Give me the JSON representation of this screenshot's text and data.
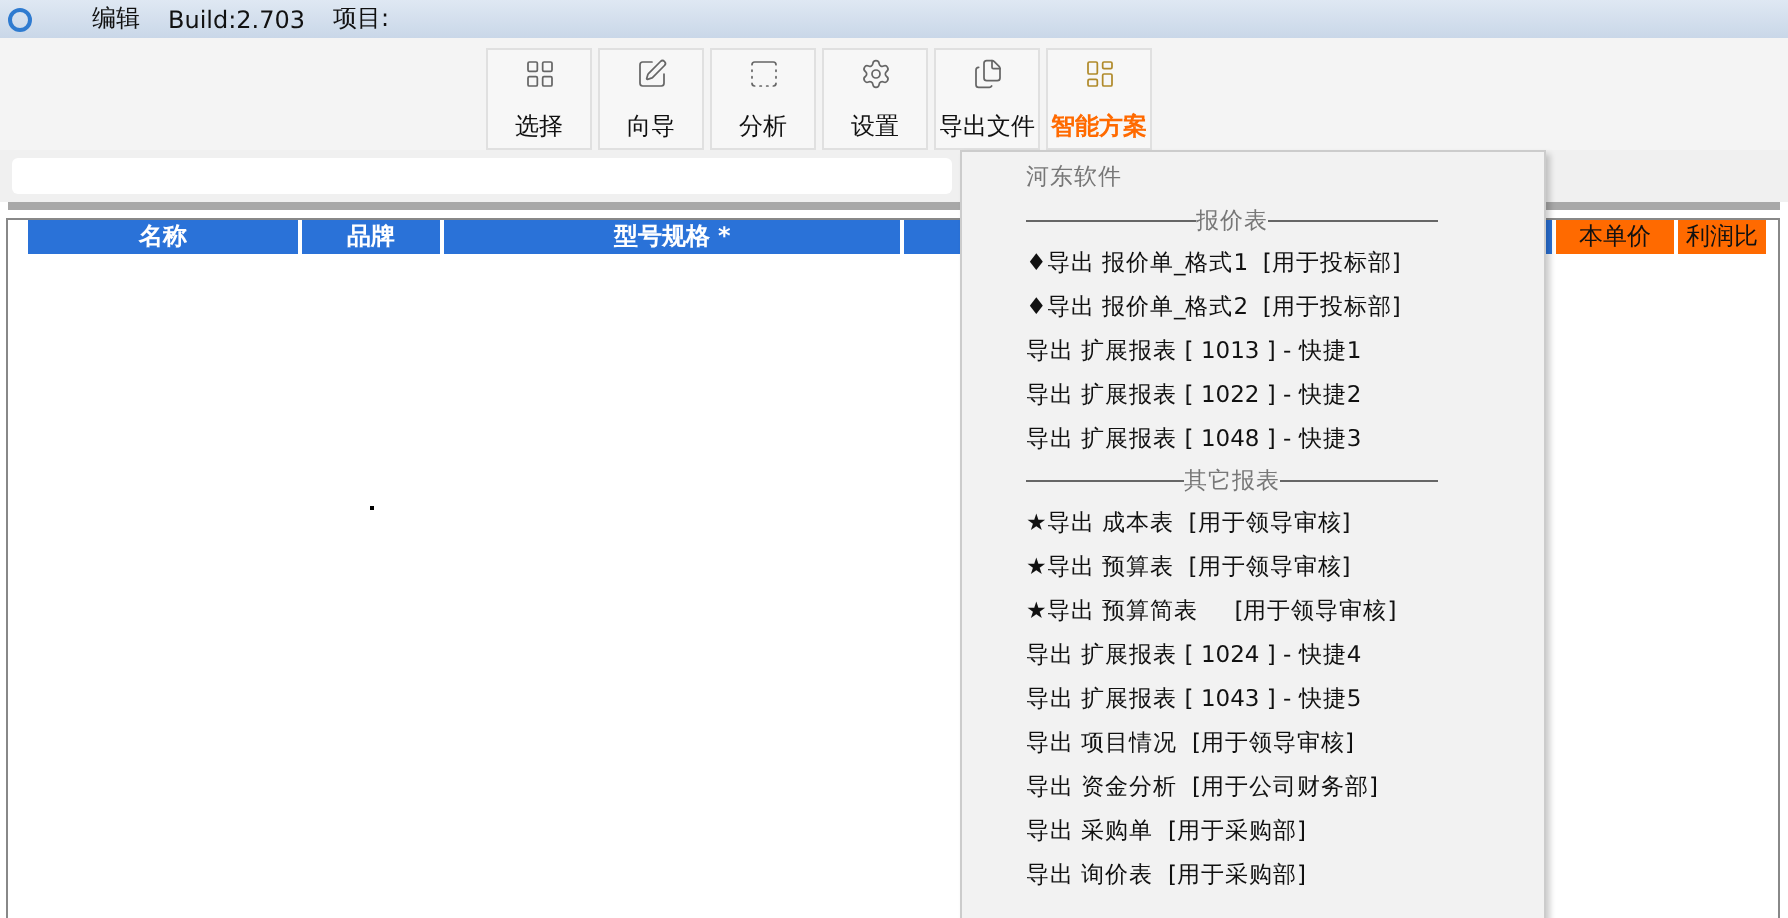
{
  "title_bar": {
    "menu": [
      "编辑"
    ],
    "build": "Build:2.703",
    "project": "项目:"
  },
  "toolbar": [
    {
      "label": "选择",
      "highlight": false
    },
    {
      "label": "向导",
      "highlight": false
    },
    {
      "label": "分析",
      "highlight": false
    },
    {
      "label": "设置",
      "highlight": false
    },
    {
      "label": "导出文件",
      "highlight": false
    },
    {
      "label": "智能方案",
      "highlight": true
    }
  ],
  "table": {
    "columns": [
      {
        "label": "名称",
        "kind": "main"
      },
      {
        "label": "品牌",
        "kind": "main"
      },
      {
        "label": "型号规格 *",
        "kind": "main"
      },
      {
        "kind": "main"
      },
      {
        "label": "本单价",
        "kind": "cost"
      },
      {
        "label": "利润比",
        "kind": "cost"
      }
    ]
  },
  "dropdown_menu": [
    {
      "kind": "header",
      "label": "河东软件"
    },
    {
      "kind": "separator",
      "label": "报价表"
    },
    {
      "kind": "item",
      "label": "♦导出 报价单_格式1  [用于投标部]"
    },
    {
      "kind": "item",
      "label": "♦导出 报价单_格式2  [用于投标部]"
    },
    {
      "kind": "item",
      "label": "导出 扩展报表 [ 1013 ] - 快捷1"
    },
    {
      "kind": "item",
      "label": "导出 扩展报表 [ 1022 ] - 快捷2"
    },
    {
      "kind": "item",
      "label": "导出 扩展报表 [ 1048 ] - 快捷3"
    },
    {
      "kind": "separator",
      "label": "其它报表"
    },
    {
      "kind": "item",
      "label": "★导出 成本表  [用于领导审核]"
    },
    {
      "kind": "item",
      "label": "★导出 预算表  [用于领导审核]"
    },
    {
      "kind": "item",
      "label": "★导出 预算简表     [用于领导审核]"
    },
    {
      "kind": "item",
      "label": "导出 扩展报表 [ 1024 ] - 快捷4"
    },
    {
      "kind": "item",
      "label": "导出 扩展报表 [ 1043 ] - 快捷5"
    },
    {
      "kind": "item",
      "label": "导出 项目情况  [用于领导审核]"
    },
    {
      "kind": "item",
      "label": "导出 资金分析  [用于公司财务部]"
    },
    {
      "kind": "item",
      "label": "导出 采购单  [用于采购部]"
    },
    {
      "kind": "item",
      "label": "导出 询价表  [用于采购部]"
    }
  ]
}
